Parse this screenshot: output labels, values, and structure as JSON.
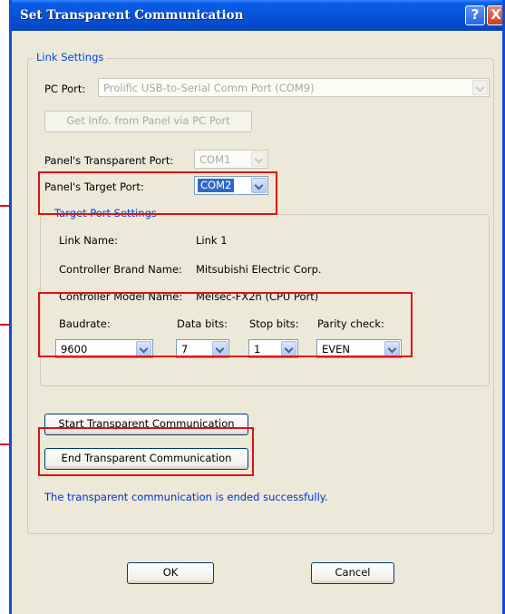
{
  "window": {
    "title": "Set Transparent Communication",
    "help_label": "?",
    "close_label": "X"
  },
  "link_settings": {
    "legend": "Link Settings",
    "pc_port_label": "PC Port:",
    "pc_port_value": "Prolific USB-to-Serial Comm Port (COM9)",
    "get_info_button": "Get Info. from Panel via PC Port",
    "transparent_port_label": "Panel's Transparent Port:",
    "transparent_port_value": "COM1",
    "target_port_label": "Panel's Target Port:",
    "target_port_value": "COM2"
  },
  "target_port_settings": {
    "legend": "Target Port Settings",
    "link_name_label": "Link Name:",
    "link_name_value": "Link 1",
    "brand_label": "Controller Brand Name:",
    "brand_value": "Mitsubishi Electric Corp.",
    "model_label": "Controller Model Name:",
    "model_value": "Melsec-FX2n (CPU Port)",
    "baudrate_label": "Baudrate:",
    "baudrate_value": "9600",
    "data_bits_label": "Data bits:",
    "data_bits_value": "7",
    "stop_bits_label": "Stop bits:",
    "stop_bits_value": "1",
    "parity_label": "Parity check:",
    "parity_value": "EVEN"
  },
  "actions": {
    "start_button": "Start Transparent Communication",
    "end_button": "End Transparent Communication",
    "status_message": "The transparent communication is ended successfully."
  },
  "footer": {
    "ok_label": "OK",
    "cancel_label": "Cancel"
  },
  "colors": {
    "annotation": "#e01010",
    "titlebar": "#0753d8",
    "dialog_bg": "#ece9d8",
    "status_text": "#0033cc"
  }
}
